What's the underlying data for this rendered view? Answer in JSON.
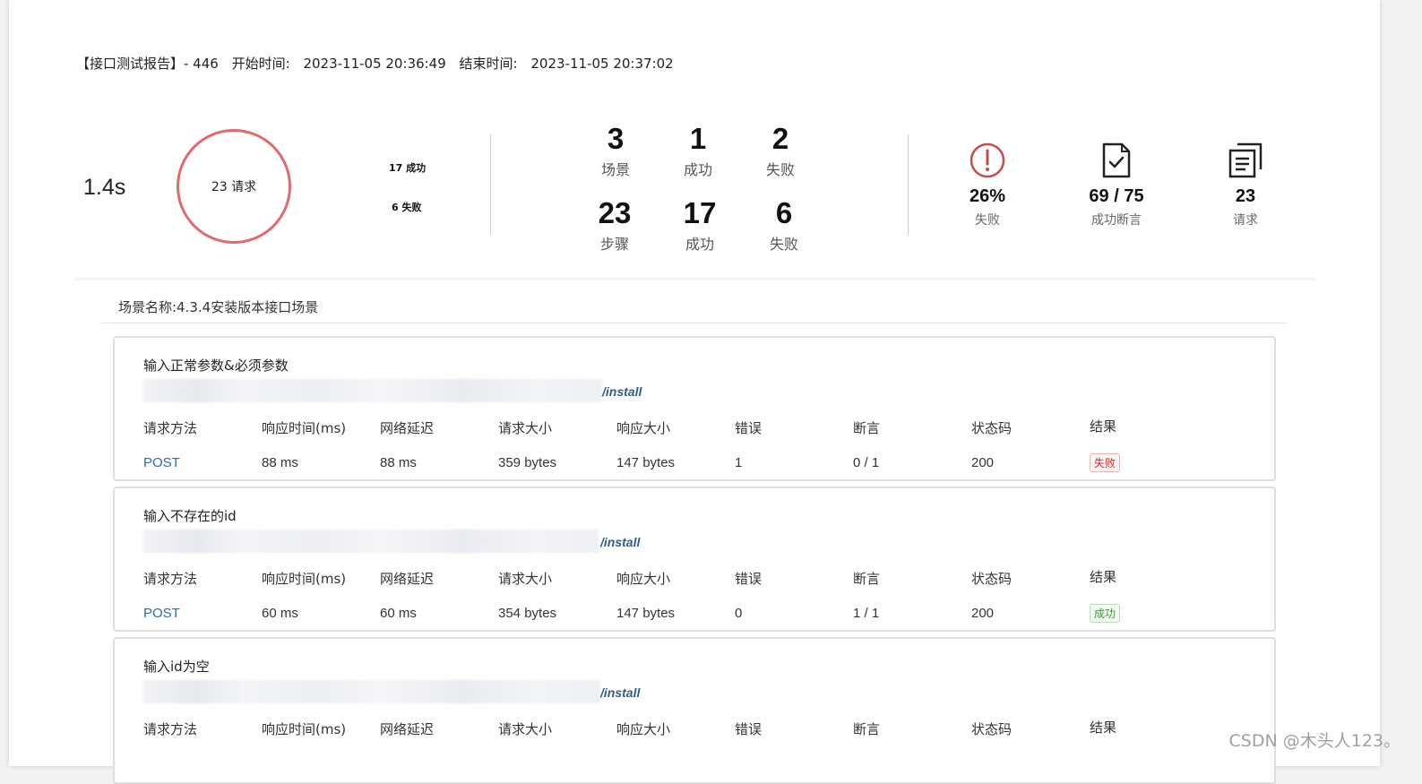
{
  "header": {
    "title": "【接口测试报告】- 446",
    "start_label": "开始时间:",
    "start_time": "2023-11-05 20:36:49",
    "end_label": "结束时间:",
    "end_time": "2023-11-05 20:37:02"
  },
  "summary": {
    "duration": "1.4s",
    "ring_label": "23 请求",
    "ring_success": "17 成功",
    "ring_fail": "6 失败",
    "stats": [
      {
        "num": "3",
        "label": "场景"
      },
      {
        "num": "1",
        "label": "成功"
      },
      {
        "num": "2",
        "label": "失败"
      },
      {
        "num": "23",
        "label": "步骤"
      },
      {
        "num": "17",
        "label": "成功"
      },
      {
        "num": "6",
        "label": "失败"
      }
    ],
    "metrics": [
      {
        "value": "26%",
        "label": "失败",
        "icon": "exclamation-circle-icon"
      },
      {
        "value": "69 / 75",
        "label": "成功断言",
        "icon": "file-check-icon"
      },
      {
        "value": "23",
        "label": "请求",
        "icon": "copy-list-icon"
      }
    ],
    "colors": {
      "ring": "#e4686c",
      "fail_icon": "#c94a4a"
    }
  },
  "scene": {
    "title": "场景名称:4.3.4安装版本接口场景"
  },
  "columns": [
    "请求方法",
    "响应时间(ms)",
    "网络延迟",
    "请求大小",
    "响应大小",
    "错误",
    "断言",
    "状态码",
    "结果"
  ],
  "cards": [
    {
      "title": "输入正常参数&必须参数",
      "url_path": "/install",
      "values": [
        "POST",
        "88 ms",
        "88 ms",
        "359 bytes",
        "147 bytes",
        "1",
        "0 / 1",
        "200"
      ],
      "result": "失败"
    },
    {
      "title": "输入不存在的id",
      "url_path": "/install",
      "values": [
        "POST",
        "60 ms",
        "60 ms",
        "354 bytes",
        "147 bytes",
        "0",
        "1 / 1",
        "200"
      ],
      "result": "成功"
    },
    {
      "title": "输入id为空",
      "url_path": "/install"
    }
  ],
  "watermark": "CSDN @木头人123。"
}
